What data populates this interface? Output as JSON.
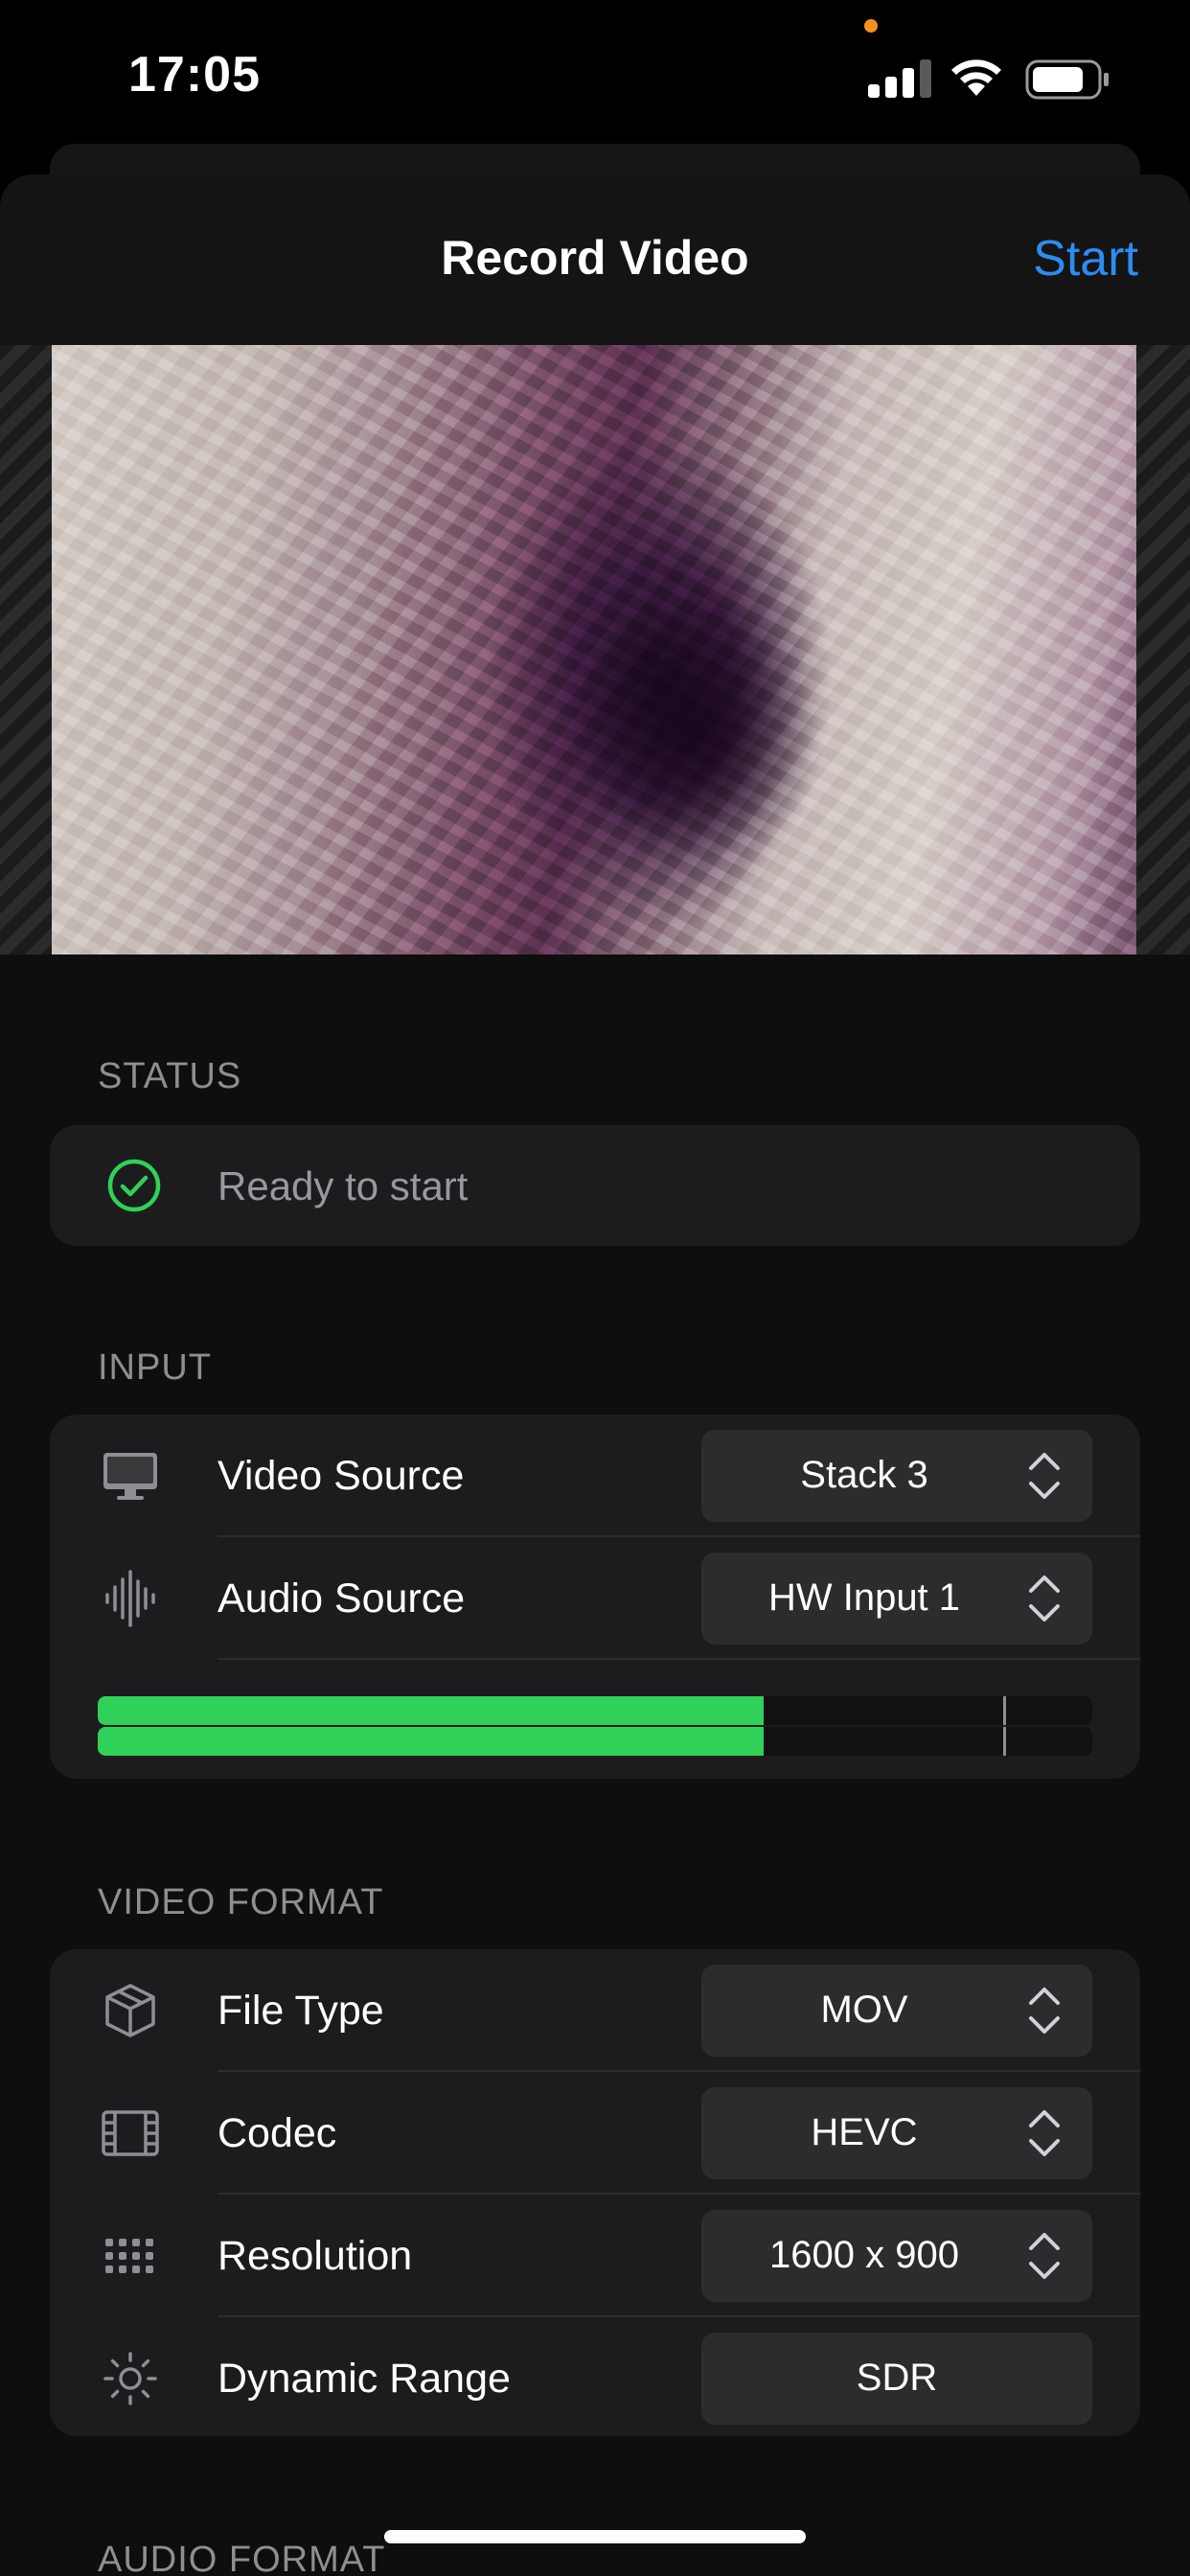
{
  "status_bar": {
    "time": "17:05",
    "signal_icon": "cellular-signal-icon",
    "wifi_icon": "wifi-icon",
    "battery_icon": "battery-icon",
    "recording_dot_color": "#f2911b"
  },
  "nav": {
    "title": "Record Video",
    "start_label": "Start",
    "accent_color": "#2b8cf2"
  },
  "preview": {
    "description_icon": "video-preview-image"
  },
  "status_section": {
    "header": "STATUS",
    "icon": "checkmark-circle-icon",
    "icon_color": "#30d158",
    "text": "Ready to start"
  },
  "input_section": {
    "header": "INPUT",
    "rows": [
      {
        "icon": "display-icon",
        "label": "Video Source",
        "value": "Stack 3"
      },
      {
        "icon": "waveform-icon",
        "label": "Audio Source",
        "value": "HW Input 1"
      }
    ],
    "audio_meter": {
      "level": 0.67,
      "peak_marker": 0.91,
      "color": "#30d158"
    }
  },
  "video_format_section": {
    "header": "VIDEO FORMAT",
    "rows": [
      {
        "icon": "cube-icon",
        "label": "File Type",
        "value": "MOV"
      },
      {
        "icon": "film-icon",
        "label": "Codec",
        "value": "HEVC"
      },
      {
        "icon": "grid-dots-icon",
        "label": "Resolution",
        "value": "1600 x 900"
      },
      {
        "icon": "sun-icon",
        "label": "Dynamic Range",
        "value": "SDR"
      }
    ]
  },
  "audio_format_section": {
    "header": "AUDIO FORMAT"
  }
}
